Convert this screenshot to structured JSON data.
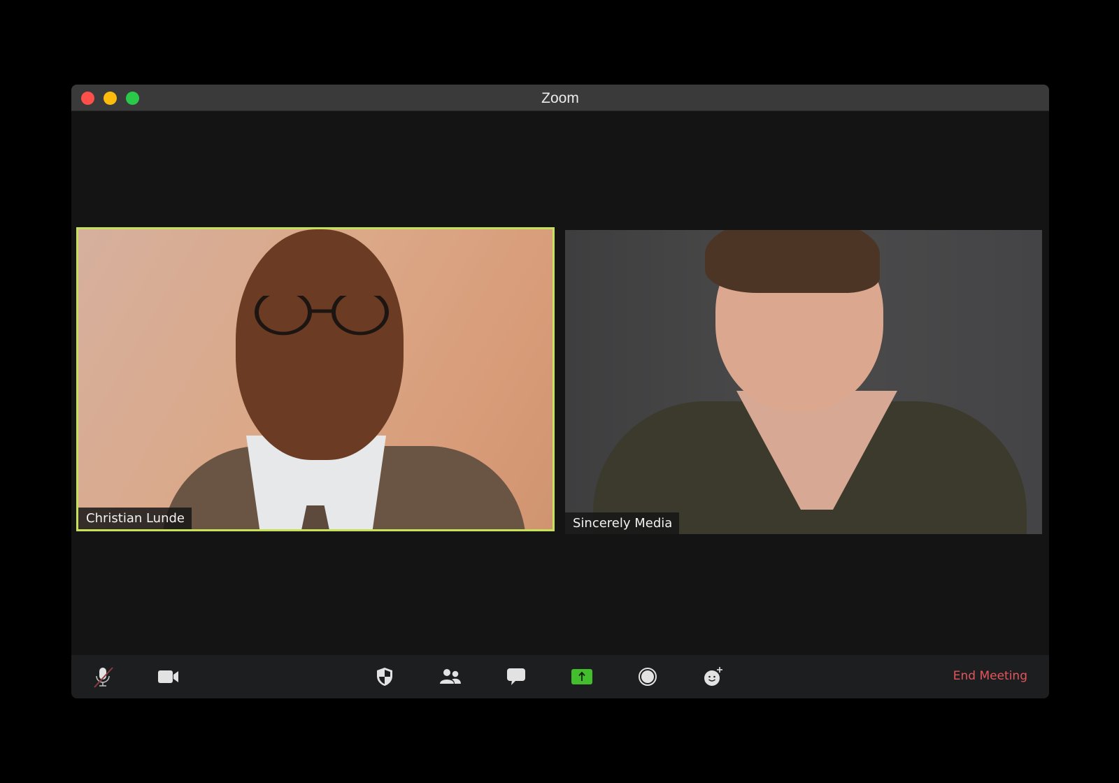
{
  "window": {
    "title": "Zoom",
    "traffic_lights": [
      "close",
      "minimize",
      "maximize"
    ]
  },
  "participants": [
    {
      "name": "Christian Lunde",
      "active_speaker": true,
      "highlight_color": "#c7e15a"
    },
    {
      "name": "Sincerely Media",
      "active_speaker": false
    }
  ],
  "toolbar": {
    "buttons": [
      {
        "icon": "microphone-muted-icon",
        "state": "muted"
      },
      {
        "icon": "video-camera-icon"
      },
      {
        "icon": "security-shield-icon"
      },
      {
        "icon": "participants-icon"
      },
      {
        "icon": "chat-bubble-icon"
      },
      {
        "icon": "share-screen-icon",
        "accent": "#43bf2e"
      },
      {
        "icon": "record-icon"
      },
      {
        "icon": "reactions-icon"
      }
    ],
    "end_meeting_label": "End Meeting",
    "end_meeting_color": "#e5555c"
  }
}
